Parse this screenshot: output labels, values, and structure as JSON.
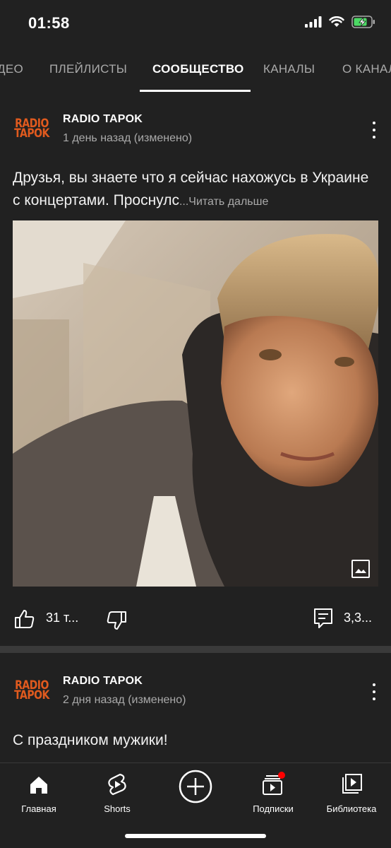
{
  "status_bar": {
    "time": "01:58"
  },
  "tabs": [
    {
      "label": "ДЕО"
    },
    {
      "label": "ПЛЕЙЛИСТЫ"
    },
    {
      "label": "СООБЩЕСТВО"
    },
    {
      "label": "КАНАЛЫ"
    },
    {
      "label": "О КАНАЛ"
    }
  ],
  "posts": [
    {
      "avatar_lines": [
        "RADIO",
        "TAPOK"
      ],
      "channel": "RADIO TAPOK",
      "time": "1 день назад (изменено)",
      "text": "Друзья, вы знаете что я сейчас нахожусь в Украине с концертами. Проснулс",
      "read_more": "...Читать дальше",
      "likes": "31 т...",
      "comments": "3,3..."
    },
    {
      "avatar_lines": [
        "RADIO",
        "TAPOK"
      ],
      "channel": "RADIO TAPOK",
      "time": "2 дня назад (изменено)",
      "text": "С праздником мужики!"
    }
  ],
  "bottom_nav": [
    {
      "label": "Главная",
      "icon": "home-icon"
    },
    {
      "label": "Shorts",
      "icon": "shorts-icon"
    },
    {
      "label": "",
      "icon": "create-icon"
    },
    {
      "label": "Подписки",
      "icon": "subscriptions-icon"
    },
    {
      "label": "Библиотека",
      "icon": "library-icon"
    }
  ],
  "colors": {
    "background": "#212121",
    "brand_avatar": "#e05a1e",
    "notification_dot": "#ff0000",
    "battery_charging": "#4cd964"
  }
}
